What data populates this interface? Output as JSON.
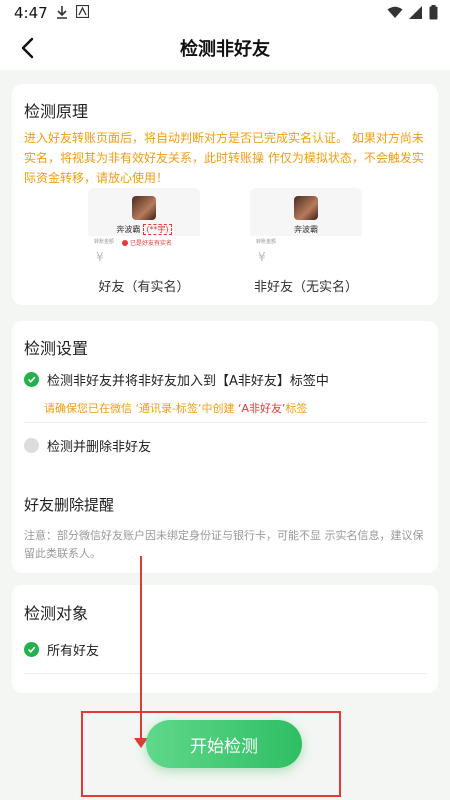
{
  "status_bar": {
    "time": "4:47"
  },
  "header": {
    "title": "检测非好友"
  },
  "principle": {
    "title": "检测原理",
    "text": "进入好友转账页面后，将自动判断对方是否已完成实名认证。 如果对方尚未实名，将视其为非有效好友关系，此时转账操 作仅为模拟状态，不会触发实际资金转移，请放心使用！",
    "friend_mock": {
      "name": "奔波霸",
      "masked_name": "(**宇)",
      "amount_label": "转账金额",
      "currency": "¥",
      "warning": "已是好友有实名",
      "caption": "好友（有实名）"
    },
    "non_friend_mock": {
      "name": "奔波霸",
      "amount_label": "转账金额",
      "currency": "¥",
      "caption": "非好友（无实名）"
    }
  },
  "settings": {
    "title": "检测设置",
    "option1": "检测非好友并将非好友加入到【A非好友】标签中",
    "hint_prefix": "请确保您已在微信 ‘通讯录-标签’中创建 ",
    "hint_tag": "‘A非好友’",
    "hint_suffix": "标签",
    "option2": "检测并删除非好友",
    "reminder_title": "好友删除提醒",
    "reminder_text": "注意：部分微信好友账户因未绑定身份证与银行卡，可能不显 示实名信息，建议保留此类联系人。"
  },
  "target": {
    "title": "检测对象",
    "option1": "所有好友"
  },
  "start_button": {
    "label": "开始检测"
  },
  "colors": {
    "accent": "#22b14c",
    "warning": "#f39c12",
    "annotation": "#e53935"
  }
}
